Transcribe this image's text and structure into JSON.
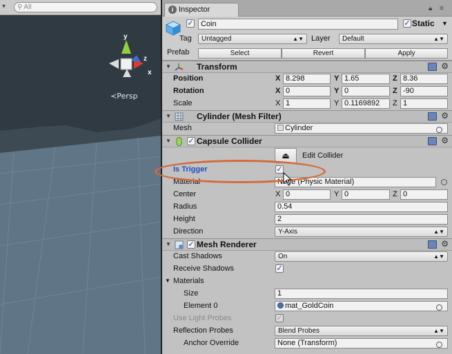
{
  "scene": {
    "search_placeholder": "All",
    "persp_label": "Persp",
    "gizmo_axes": [
      "y",
      "z",
      "x"
    ]
  },
  "inspector": {
    "tab_label": "Inspector",
    "object": {
      "name": "Coin",
      "static_label": "Static",
      "tag_label": "Tag",
      "tag_value": "Untagged",
      "layer_label": "Layer",
      "layer_value": "Default",
      "prefab_label": "Prefab",
      "select_label": "Select",
      "revert_label": "Revert",
      "apply_label": "Apply"
    },
    "transform": {
      "title": "Transform",
      "position_label": "Position",
      "rotation_label": "Rotation",
      "scale_label": "Scale",
      "axes": [
        "X",
        "Y",
        "Z"
      ],
      "position": [
        "8.298",
        "1.65",
        "8.36"
      ],
      "rotation": [
        "0",
        "0",
        "-90"
      ],
      "scale": [
        "1",
        "0.1169892",
        "1"
      ]
    },
    "mesh_filter": {
      "title": "Cylinder (Mesh Filter)",
      "mesh_label": "Mesh",
      "mesh_value": "Cylinder"
    },
    "capsule_collider": {
      "title": "Capsule Collider",
      "edit_label": "Edit Collider",
      "is_trigger_label": "Is Trigger",
      "material_label": "Material",
      "material_value": "None (Physic Material)",
      "center_label": "Center",
      "center": [
        "0",
        "0",
        "0"
      ],
      "radius_label": "Radius",
      "radius_value": "0.54",
      "height_label": "Height",
      "height_value": "2",
      "direction_label": "Direction",
      "direction_value": "Y-Axis"
    },
    "mesh_renderer": {
      "title": "Mesh Renderer",
      "cast_shadows_label": "Cast Shadows",
      "cast_shadows_value": "On",
      "receive_shadows_label": "Receive Shadows",
      "materials_label": "Materials",
      "size_label": "Size",
      "size_value": "1",
      "element0_label": "Element 0",
      "element0_value": "mat_GoldCoin",
      "light_probes_label": "Use Light Probes",
      "reflection_probes_label": "Reflection Probes",
      "reflection_probes_value": "Blend Probes",
      "anchor_override_label": "Anchor Override",
      "anchor_override_value": "None (Transform)"
    }
  },
  "colors": {
    "highlight": "#d46a3c",
    "inspector_bg": "#c2c2c2",
    "scene_bg": "#4a5966",
    "trigger_label": "#1f4fbf"
  }
}
